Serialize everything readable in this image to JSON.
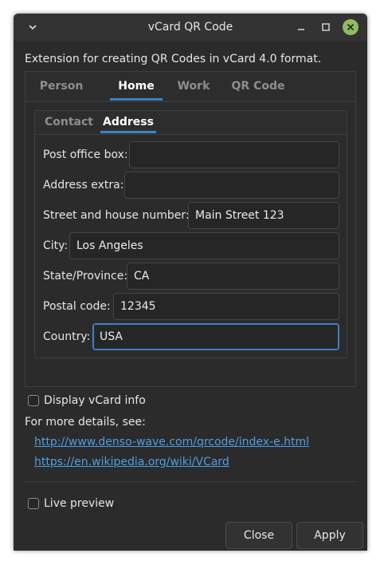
{
  "window": {
    "title": "vCard QR Code",
    "icons": {
      "menu": "chevron-down-icon",
      "minimize": "minimize-icon",
      "maximize": "maximize-icon",
      "close": "close-icon"
    }
  },
  "description": "Extension for creating QR Codes in vCard 4.0 format.",
  "outer_tabs": [
    {
      "label": "Person",
      "active": false
    },
    {
      "label": "Home",
      "active": true
    },
    {
      "label": "Work",
      "active": false
    },
    {
      "label": "QR Code",
      "active": false
    }
  ],
  "inner_tabs": [
    {
      "label": "Contact",
      "active": false
    },
    {
      "label": "Address",
      "active": true
    }
  ],
  "address_fields": [
    {
      "label": "Post office box:",
      "value": ""
    },
    {
      "label": "Address extra:",
      "value": ""
    },
    {
      "label": "Street and house number:",
      "value": "Main Street 123"
    },
    {
      "label": "City:",
      "value": "Los Angeles"
    },
    {
      "label": "State/Province:",
      "value": "CA"
    },
    {
      "label": "Postal code:",
      "value": "12345"
    },
    {
      "label": "Country:",
      "value": "USA"
    }
  ],
  "options": {
    "display_vcard_info": {
      "label": "Display vCard info",
      "checked": false
    },
    "live_preview": {
      "label": "Live preview",
      "checked": false
    }
  },
  "details": {
    "text": "For more details, see:",
    "links": [
      "http://www.denso-wave.com/qrcode/index-e.html",
      "https://en.wikipedia.org/wiki/VCard"
    ]
  },
  "buttons": {
    "close": "Close",
    "apply": "Apply"
  },
  "colors": {
    "accent": "#3e82c4",
    "link": "#4e9ee6",
    "close_button": "#8fbc5e",
    "background": "#2b2b2b"
  }
}
